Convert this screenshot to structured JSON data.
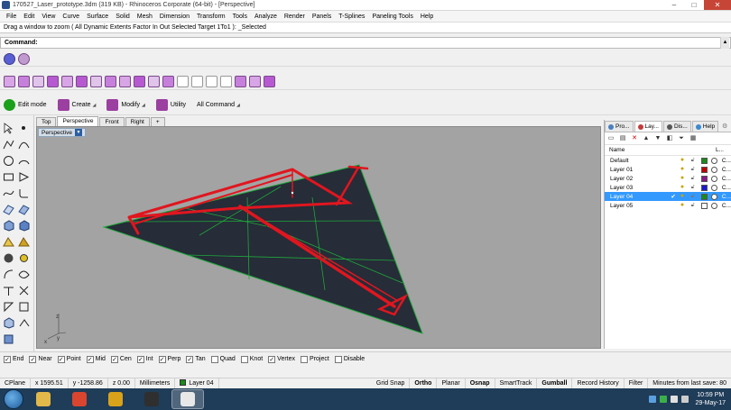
{
  "window": {
    "title": "170527_Laser_prototype.3dm (319 KB) - Rhinoceros Corporate (64-bit) - [Perspective]",
    "controls": [
      "–",
      "□",
      "✕"
    ]
  },
  "menubar": [
    "File",
    "Edit",
    "View",
    "Curve",
    "Surface",
    "Solid",
    "Mesh",
    "Dimension",
    "Transform",
    "Tools",
    "Analyze",
    "Render",
    "Panels",
    "T-Splines",
    "Paneling Tools",
    "Help"
  ],
  "command_history": "Drag a window to zoom ( All  Dynamic  Extents  Factor  In  Out  Selected  Target  1To1 ): _Selected",
  "command": {
    "label": "Command:",
    "value": ""
  },
  "toolbar_tabs": [
    {
      "label": "Edit mode",
      "icon": "edit-mode-icon",
      "color": "#1aa01a"
    },
    {
      "label": "Create",
      "icon": "create-icon",
      "color": "#9b3fa0"
    },
    {
      "label": "Modify",
      "icon": "modify-icon",
      "color": "#9b3fa0"
    },
    {
      "label": "Utility",
      "icon": "utility-icon",
      "color": "#9b3fa0"
    },
    {
      "label": "All Command",
      "icon": "",
      "color": ""
    }
  ],
  "viewport_tabs": [
    "Top",
    "Perspective",
    "Front",
    "Right",
    "+"
  ],
  "viewport": {
    "label": "Perspective",
    "background": "#a3a3a3",
    "surface_color": "#262c38",
    "grid_color": "#1fa83a",
    "selection_color": "#e0161f",
    "axis_labels": {
      "z": "z",
      "y": "y",
      "x": "x"
    }
  },
  "panel": {
    "tabs": [
      "Pro...",
      "Lay...",
      "Dis...",
      "Help"
    ],
    "tab_colors": [
      "#4a7fc1",
      "#c43a3a",
      "#555555",
      "#3a8ad0"
    ],
    "columns": {
      "name": "Name",
      "linetype": "L..."
    },
    "toolbar_icons": [
      "new-layer-icon",
      "new-sublayer-icon",
      "delete-layer-icon",
      "move-up-icon",
      "move-down-icon",
      "up-level-icon",
      "filter-icon",
      "tools-icon"
    ],
    "layers": [
      {
        "name": "Default",
        "color": "#000000",
        "current": false,
        "selected": false,
        "linetype": "C..."
      },
      {
        "name": "Layer 01",
        "color": "#c00000",
        "current": false,
        "selected": false,
        "linetype": "C..."
      },
      {
        "name": "Layer 02",
        "color": "#8a1a8a",
        "current": false,
        "selected": false,
        "linetype": "C..."
      },
      {
        "name": "Layer 03",
        "color": "#1a1ad0",
        "current": false,
        "selected": false,
        "linetype": "C..."
      },
      {
        "name": "Layer 04",
        "color": "#1a8a1a",
        "current": true,
        "selected": true,
        "linetype": "C..."
      },
      {
        "name": "Layer 05",
        "color": "#ffffff",
        "current": false,
        "selected": false,
        "linetype": "C..."
      }
    ]
  },
  "osnaps": [
    {
      "label": "End",
      "checked": true
    },
    {
      "label": "Near",
      "checked": true
    },
    {
      "label": "Point",
      "checked": true
    },
    {
      "label": "Mid",
      "checked": true
    },
    {
      "label": "Cen",
      "checked": true
    },
    {
      "label": "Int",
      "checked": true
    },
    {
      "label": "Perp",
      "checked": true
    },
    {
      "label": "Tan",
      "checked": true
    },
    {
      "label": "Quad",
      "checked": false
    },
    {
      "label": "Knot",
      "checked": false
    },
    {
      "label": "Vertex",
      "checked": true
    },
    {
      "label": "Project",
      "checked": false
    },
    {
      "label": "Disable",
      "checked": false
    }
  ],
  "status": {
    "cplane": "CPlane",
    "x": "x 1595.51",
    "y": "y -1258.86",
    "z": "z 0.00",
    "units": "Millimeters",
    "layer": "Layer 04",
    "layer_color": "#1a8a1a",
    "grid_snap": "Grid Snap",
    "ortho": "Ortho",
    "planar": "Planar",
    "osnap": "Osnap",
    "smarttrack": "SmartTrack",
    "gumball": "Gumball",
    "record_history": "Record History",
    "filter": "Filter",
    "minutes": "Minutes from last save: 80"
  },
  "taskbar": {
    "apps": [
      {
        "name": "explorer",
        "color": "#e2b84a"
      },
      {
        "name": "chrome",
        "color": "#d9452f"
      },
      {
        "name": "illustrator",
        "color": "#d8a21a"
      },
      {
        "name": "muse",
        "color": "#2f2f2f"
      },
      {
        "name": "rhino",
        "color": "#e8e8e8"
      }
    ],
    "time": "10:59 PM",
    "date": "29-May-17"
  }
}
